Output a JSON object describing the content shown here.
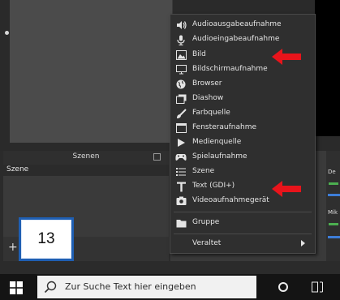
{
  "scenes": {
    "title": "Szenen",
    "items": [
      "Szene"
    ],
    "add_symbol": "+"
  },
  "mixer": {
    "labels": [
      "De",
      "Mik"
    ]
  },
  "step_badge": {
    "number": "13"
  },
  "context_menu": {
    "items": [
      {
        "label": "Audioausgabeaufnahme",
        "icon": "speaker-icon"
      },
      {
        "label": "Audioeingabeaufnahme",
        "icon": "microphone-icon"
      },
      {
        "label": "Bild",
        "icon": "image-icon"
      },
      {
        "label": "Bildschirmaufnahme",
        "icon": "monitor-icon"
      },
      {
        "label": "Browser",
        "icon": "globe-icon"
      },
      {
        "label": "Diashow",
        "icon": "slideshow-icon"
      },
      {
        "label": "Farbquelle",
        "icon": "paintbrush-icon"
      },
      {
        "label": "Fensteraufnahme",
        "icon": "window-icon"
      },
      {
        "label": "Medienquelle",
        "icon": "play-icon"
      },
      {
        "label": "Spielaufnahme",
        "icon": "gamepad-icon"
      },
      {
        "label": "Szene",
        "icon": "list-icon"
      },
      {
        "label": "Text (GDI+)",
        "icon": "text-icon"
      },
      {
        "label": "Videoaufnahmegerät",
        "icon": "camera-icon"
      }
    ],
    "group_label": "Gruppe",
    "deprecated_label": "Veraltet"
  },
  "highlight_color": "#e8141b",
  "taskbar": {
    "search_placeholder": "Zur Suche Text hier eingeben"
  }
}
